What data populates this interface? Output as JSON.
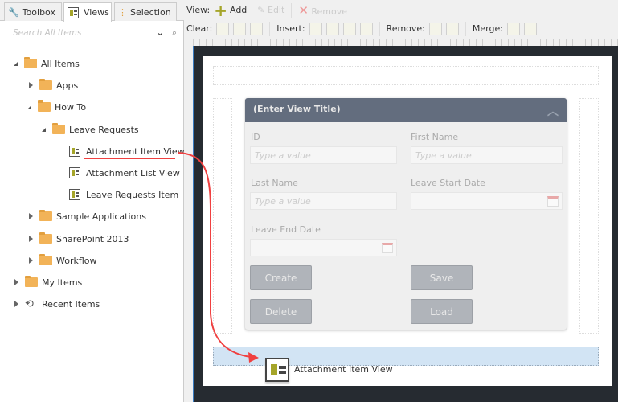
{
  "tabs": [
    {
      "label": "Toolbox",
      "icon": "wrench-icon"
    },
    {
      "label": "Views",
      "icon": "view-icon"
    },
    {
      "label": "Selection",
      "icon": "selection-icon"
    }
  ],
  "search": {
    "placeholder": "Search All Items"
  },
  "tree": {
    "all_items": "All Items",
    "apps": "Apps",
    "how_to": "How To",
    "leave_requests": "Leave Requests",
    "attachment_item_view": "Attachment Item View",
    "attachment_list_view": "Attachment List View",
    "leave_requests_item": "Leave Requests Item",
    "sample_applications": "Sample Applications",
    "sharepoint_2013": "SharePoint 2013",
    "workflow": "Workflow",
    "my_items": "My Items",
    "recent_items": "Recent Items"
  },
  "toolbar": {
    "view_label": "View:",
    "add": "Add",
    "edit": "Edit",
    "remove": "Remove",
    "clear_label": "Clear:",
    "insert_label": "Insert:",
    "remove_label": "Remove:",
    "merge_label": "Merge:"
  },
  "form": {
    "title": "(Enter View Title)",
    "id_label": "ID",
    "first_name_label": "First Name",
    "last_name_label": "Last Name",
    "leave_start_label": "Leave Start Date",
    "leave_end_label": "Leave End Date",
    "placeholder": "Type a value",
    "create": "Create",
    "save": "Save",
    "delete": "Delete",
    "load": "Load"
  },
  "drag": {
    "label": "Attachment Item View"
  },
  "colors": {
    "header": "#636d7e",
    "drop_zone": "#d2e4f4",
    "arrow": "#f04040",
    "canvas_bg": "#262b31"
  }
}
